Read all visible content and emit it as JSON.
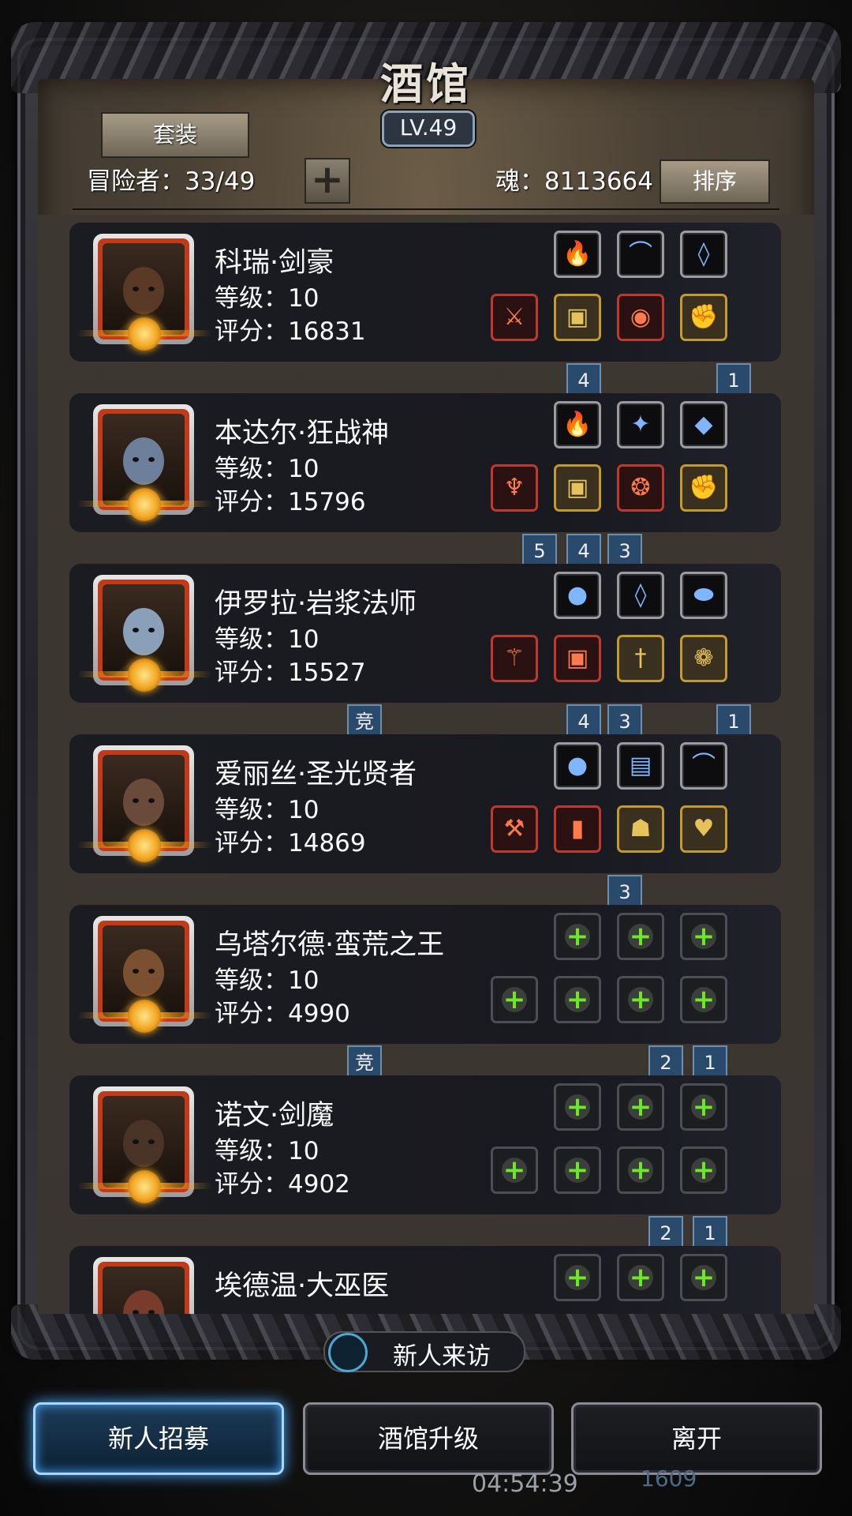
{
  "header": {
    "title": "酒馆",
    "level": "LV.49",
    "suit_label": "套装",
    "adventurers": "冒险者：33/49",
    "add_label": "+",
    "soul": "魂：8113664",
    "sort_label": "排序"
  },
  "heroes": [
    {
      "name": "科瑞·剑豪",
      "level": "等级：10",
      "score": "评分：16831",
      "top": [
        {
          "icon": "fire-orb",
          "glyph": "🔥",
          "frame": "silver"
        },
        {
          "icon": "bow",
          "glyph": "⌒",
          "frame": "silver"
        },
        {
          "icon": "necklace",
          "glyph": "◊",
          "frame": "silver"
        }
      ],
      "bottom": [
        {
          "icon": "sword",
          "glyph": "⚔",
          "frame": "red"
        },
        {
          "icon": "armor",
          "glyph": "▣",
          "frame": "gold"
        },
        {
          "icon": "eye-gem",
          "glyph": "◉",
          "frame": "red"
        },
        {
          "icon": "gauntlet",
          "glyph": "✊",
          "frame": "gold"
        }
      ],
      "tags": [
        {
          "text": "4"
        },
        {
          "text": "1"
        }
      ]
    },
    {
      "name": "本达尔·狂战神",
      "level": "等级：10",
      "score": "评分：15796",
      "top": [
        {
          "icon": "fire-orb",
          "glyph": "🔥",
          "frame": "silver"
        },
        {
          "icon": "crest",
          "glyph": "✦",
          "frame": "silver"
        },
        {
          "icon": "purple-gem",
          "glyph": "◆",
          "frame": "silver"
        }
      ],
      "bottom": [
        {
          "icon": "trident",
          "glyph": "♆",
          "frame": "red"
        },
        {
          "icon": "armor",
          "glyph": "▣",
          "frame": "gold"
        },
        {
          "icon": "amulet",
          "glyph": "❂",
          "frame": "red"
        },
        {
          "icon": "gauntlet",
          "glyph": "✊",
          "frame": "gold"
        }
      ],
      "tags": [
        {
          "text": "5"
        },
        {
          "text": "4"
        },
        {
          "text": "3"
        }
      ]
    },
    {
      "name": "伊罗拉·岩浆法师",
      "level": "等级：10",
      "score": "评分：15527",
      "top": [
        {
          "icon": "blue-orb",
          "glyph": "●",
          "frame": "silver"
        },
        {
          "icon": "necklace",
          "glyph": "◊",
          "frame": "silver"
        },
        {
          "icon": "green-stone",
          "glyph": "⬬",
          "frame": "silver"
        }
      ],
      "bottom": [
        {
          "icon": "staff",
          "glyph": "⚚",
          "frame": "red"
        },
        {
          "icon": "green-armor",
          "glyph": "▣",
          "frame": "red"
        },
        {
          "icon": "dagger",
          "glyph": "†",
          "frame": "gold"
        },
        {
          "icon": "green-ring",
          "glyph": "❁",
          "frame": "gold"
        }
      ],
      "tags": [
        {
          "text": "竞"
        },
        {
          "text": "4"
        },
        {
          "text": "3"
        },
        {
          "text": "1"
        }
      ]
    },
    {
      "name": "爱丽丝·圣光贤者",
      "level": "等级：10",
      "score": "评分：14869",
      "top": [
        {
          "icon": "blue-orb",
          "glyph": "●",
          "frame": "silver"
        },
        {
          "icon": "tome",
          "glyph": "▤",
          "frame": "silver"
        },
        {
          "icon": "bow",
          "glyph": "⌒",
          "frame": "silver"
        }
      ],
      "bottom": [
        {
          "icon": "hammer",
          "glyph": "⚒",
          "frame": "red"
        },
        {
          "icon": "red-robe",
          "glyph": "▮",
          "frame": "red"
        },
        {
          "icon": "green-hood",
          "glyph": "☗",
          "frame": "gold"
        },
        {
          "icon": "heart-pendant",
          "glyph": "♥",
          "frame": "gold"
        }
      ],
      "tags": [
        {
          "text": "3"
        }
      ]
    },
    {
      "name": "乌塔尔德·蛮荒之王",
      "level": "等级：10",
      "score": "评分：4990",
      "top": [
        {
          "icon": "add-slot",
          "empty": true
        },
        {
          "icon": "add-slot",
          "empty": true
        },
        {
          "icon": "add-slot",
          "empty": true
        }
      ],
      "bottom": [
        {
          "icon": "add-slot",
          "empty": true
        },
        {
          "icon": "add-slot",
          "empty": true
        },
        {
          "icon": "add-slot",
          "empty": true
        },
        {
          "icon": "add-slot",
          "empty": true
        }
      ],
      "tags": [
        {
          "text": "竞"
        },
        {
          "text": "2"
        },
        {
          "text": "1"
        }
      ]
    },
    {
      "name": "诺文·剑魔",
      "level": "等级：10",
      "score": "评分：4902",
      "top": [
        {
          "icon": "add-slot",
          "empty": true
        },
        {
          "icon": "add-slot",
          "empty": true
        },
        {
          "icon": "add-slot",
          "empty": true
        }
      ],
      "bottom": [
        {
          "icon": "add-slot",
          "empty": true
        },
        {
          "icon": "add-slot",
          "empty": true
        },
        {
          "icon": "add-slot",
          "empty": true
        },
        {
          "icon": "add-slot",
          "empty": true
        }
      ],
      "tags": [
        {
          "text": "2"
        },
        {
          "text": "1"
        }
      ]
    },
    {
      "name": "埃德温·大巫医",
      "level": "",
      "score": "",
      "top": [
        {
          "icon": "add-slot",
          "empty": true
        },
        {
          "icon": "add-slot",
          "empty": true
        },
        {
          "icon": "add-slot",
          "empty": true
        }
      ],
      "bottom": [],
      "tags": []
    }
  ],
  "visit_label": "新人来访",
  "buttons": {
    "recruit": "新人招募",
    "upgrade": "酒馆升级",
    "leave": "离开"
  },
  "background": {
    "timer": "04:54:39",
    "number": "1609"
  },
  "colors": {
    "accent_blue": "#4aa8ff",
    "plus_green": "#6fe62c",
    "portrait_red": "#c13a1a"
  }
}
